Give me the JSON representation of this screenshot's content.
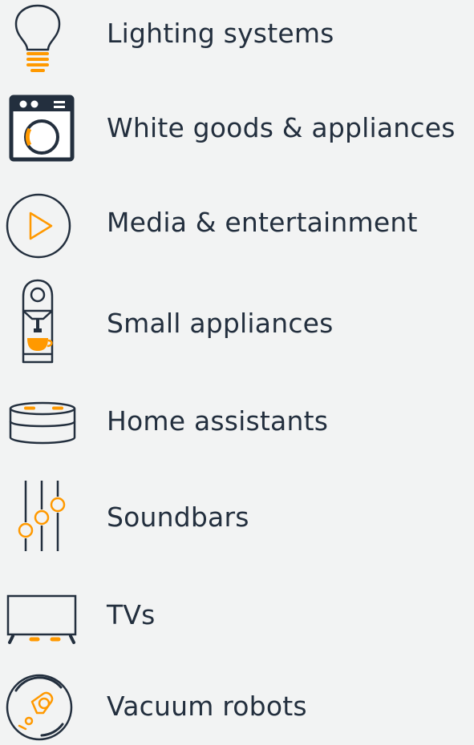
{
  "categories": [
    {
      "label": "Lighting systems",
      "icon": "light-bulb-icon"
    },
    {
      "label": "White goods & appliances",
      "icon": "washing-machine-icon"
    },
    {
      "label": "Media & entertainment",
      "icon": "play-icon"
    },
    {
      "label": "Small appliances",
      "icon": "coffee-machine-icon"
    },
    {
      "label": "Home assistants",
      "icon": "smart-speaker-icon"
    },
    {
      "label": "Soundbars",
      "icon": "equalizer-sliders-icon"
    },
    {
      "label": "TVs",
      "icon": "tv-icon"
    },
    {
      "label": "Vacuum robots",
      "icon": "robot-vacuum-icon"
    }
  ],
  "colors": {
    "background": "#f2f3f3",
    "text": "#232f3e",
    "icon_stroke": "#232f3e",
    "accent": "#ff9900"
  }
}
